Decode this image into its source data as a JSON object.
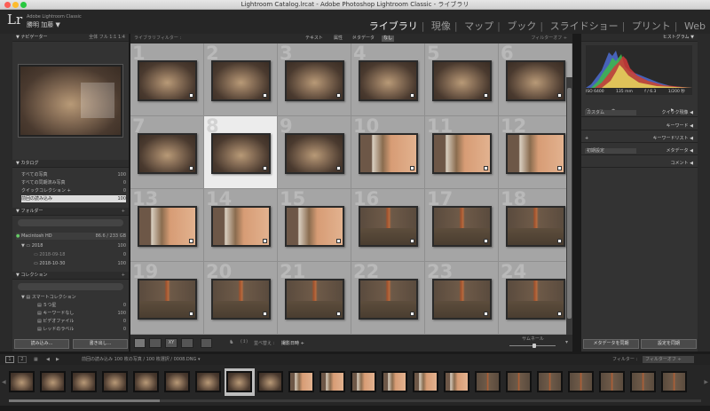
{
  "window": {
    "title": "Lightroom Catalog.lrcat - Adobe Photoshop Lightroom Classic - ライブラリ"
  },
  "identity": {
    "app": "Adobe Lightroom Classic",
    "user": "勝明 加藤 ▼",
    "logo": "Lr"
  },
  "modules": [
    "ライブラリ",
    "現像",
    "マップ",
    "ブック",
    "スライドショー",
    "プリント",
    "Web"
  ],
  "left_panel": {
    "navigator": {
      "title": "ナビゲーター",
      "zoom": "全体  フル  1:1  1:4"
    },
    "catalog": {
      "title": "カタログ",
      "items": [
        {
          "label": "すべての写真",
          "count": "100"
        },
        {
          "label": "すべての同期済み写真",
          "count": "0"
        },
        {
          "label": "クイックコレクション +",
          "count": "0"
        },
        {
          "label": "前回の読み込み",
          "count": "100"
        }
      ]
    },
    "folders": {
      "title": "フォルダー",
      "volume": "Macintosh HD",
      "volume_info": "86.6 / 233 GB",
      "items": [
        {
          "label": "2018",
          "count": "100"
        },
        {
          "label": "2018-09-18",
          "count": "0"
        },
        {
          "label": "2018-10-30",
          "count": "100"
        }
      ]
    },
    "collections": {
      "title": "コレクション",
      "items": [
        {
          "label": "スマートコレクション",
          "count": ""
        },
        {
          "label": "５つ星",
          "count": "0"
        },
        {
          "label": "キーワードなし",
          "count": "100"
        },
        {
          "label": "ビデオファイル",
          "count": "0"
        },
        {
          "label": "レッドのラベル",
          "count": "0"
        }
      ]
    },
    "import_btn": "読み込み...",
    "export_btn": "書き出し..."
  },
  "filter": {
    "title": "ライブラリフィルター :",
    "text": "テキスト",
    "attr": "属性",
    "meta": "メタデータ",
    "none": "なし",
    "preset": "フィルターオフ"
  },
  "grid": {
    "cells": [
      {
        "n": "1",
        "t": "cat"
      },
      {
        "n": "2",
        "t": "cat"
      },
      {
        "n": "3",
        "t": "cat"
      },
      {
        "n": "4",
        "t": "cat"
      },
      {
        "n": "5",
        "t": "cat"
      },
      {
        "n": "6",
        "t": "cat"
      },
      {
        "n": "7",
        "t": "cat"
      },
      {
        "n": "8",
        "t": "cat",
        "sel": true
      },
      {
        "n": "9",
        "t": "cat"
      },
      {
        "n": "10",
        "t": "leg"
      },
      {
        "n": "11",
        "t": "leg"
      },
      {
        "n": "12",
        "t": "leg"
      },
      {
        "n": "13",
        "t": "leg"
      },
      {
        "n": "14",
        "t": "leg"
      },
      {
        "n": "15",
        "t": "leg"
      },
      {
        "n": "16",
        "t": "soil"
      },
      {
        "n": "17",
        "t": "soil"
      },
      {
        "n": "18",
        "t": "soil"
      },
      {
        "n": "19",
        "t": "soil"
      },
      {
        "n": "20",
        "t": "soil"
      },
      {
        "n": "21",
        "t": "soil"
      },
      {
        "n": "22",
        "t": "soil"
      },
      {
        "n": "23",
        "t": "soil"
      },
      {
        "n": "24",
        "t": "soil"
      }
    ]
  },
  "toolbar": {
    "sort_label": "並べ替え :",
    "sort_value": "撮影日時 ÷",
    "thumb_label": "サムネール"
  },
  "right_panel": {
    "histogram": {
      "title": "ヒストグラム",
      "iso": "ISO 6400",
      "focal": "135 mm",
      "aperture": "f / 6.3",
      "shutter": "1/200 秒"
    },
    "quick_develop": {
      "preset": "カスタム",
      "title": "クイック現像"
    },
    "keywords": "キーワード",
    "keyword_list": "キーワードリスト",
    "metadata": {
      "preset": "初期設定",
      "title": "メタデータ"
    },
    "comments": "コメント",
    "sync_meta": "メタデータを同期",
    "sync_settings": "設定を同期"
  },
  "filmstrip": {
    "info": "前回の読み込み   100 枚の写真 / 100 枚選択 / 0008.DNG ▾",
    "filter_label": "フィルター :",
    "filter_value": "フィルターオフ",
    "pages": [
      "1",
      "2"
    ]
  }
}
